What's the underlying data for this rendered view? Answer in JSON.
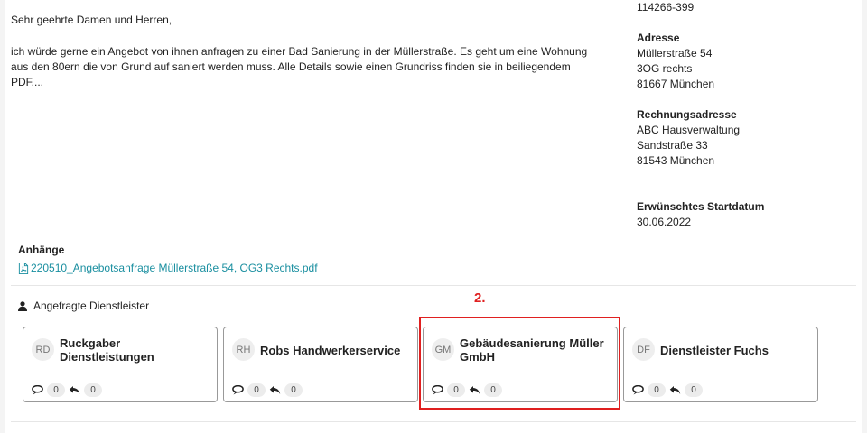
{
  "message": {
    "greeting": "Sehr geehrte Damen und Herren,",
    "body_lines": [
      "ich würde gerne ein Angebot von ihnen anfragen zu einer Bad Sanierung in der Müllerstraße. Es geht um eine Wohnung",
      "aus den 80ern die von Grund auf saniert werden muss. Alle Details sowie einen Grundriss finden sie in beiliegendem",
      "PDF...."
    ]
  },
  "info": {
    "reference": "114266-399",
    "address": {
      "label": "Adresse",
      "lines": [
        "Müllerstraße 54",
        "3OG rechts",
        "81667 München"
      ]
    },
    "billing": {
      "label": "Rechnungsadresse",
      "lines": [
        "ABC Hausverwaltung",
        "Sandstraße 33",
        "81543 München"
      ]
    },
    "start": {
      "label": "Erwünschtes Startdatum",
      "value": "30.06.2022"
    }
  },
  "attachments": {
    "label": "Anhänge",
    "icon": "pdf-file-icon",
    "file": "220510_Angebotsanfrage Müllerstraße 54, OG3 Rechts.pdf"
  },
  "providers": {
    "title": "Angefragte Dienstleister",
    "title_icon": "user-icon",
    "step_marker": "2.",
    "highlight_color": "#e02020",
    "items": [
      {
        "initials": "RD",
        "name": "Ruckgaber Dienstleistungen",
        "messages": "0",
        "replies": "0"
      },
      {
        "initials": "RH",
        "name": "Robs Handwerkerservice",
        "messages": "0",
        "replies": "0"
      },
      {
        "initials": "GM",
        "name": "Gebäudesanierung Müller GmbH",
        "messages": "0",
        "replies": "0"
      },
      {
        "initials": "DF",
        "name": "Dienstleister Fuchs",
        "messages": "0",
        "replies": "0"
      }
    ]
  }
}
